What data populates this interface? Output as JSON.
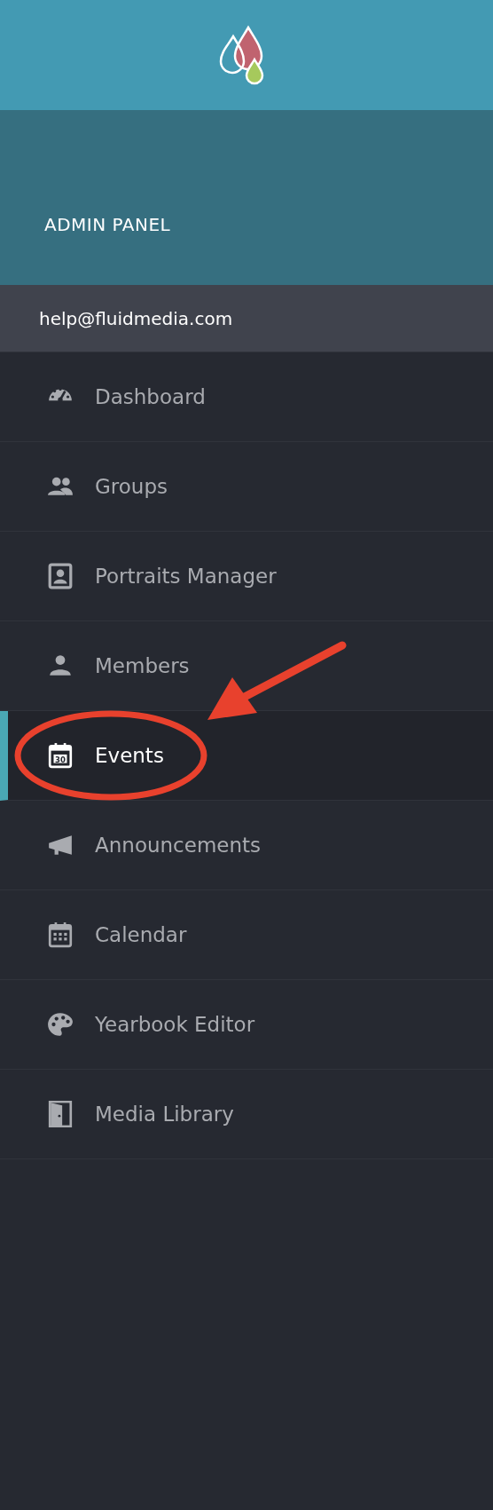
{
  "header": {
    "title": "ADMIN PANEL"
  },
  "account": {
    "email": "help@fluidmedia.com"
  },
  "menu": [
    {
      "label": "Dashboard",
      "selected": false,
      "circled": false
    },
    {
      "label": "Groups",
      "selected": false,
      "circled": false
    },
    {
      "label": "Portraits Manager",
      "selected": false,
      "circled": false
    },
    {
      "label": "Members",
      "selected": false,
      "circled": false
    },
    {
      "label": "Events",
      "icon_text": "30",
      "selected": true,
      "circled": true
    },
    {
      "label": "Announcements",
      "selected": false,
      "circled": false
    },
    {
      "label": "Calendar",
      "selected": false,
      "circled": false
    },
    {
      "label": "Yearbook Editor",
      "selected": false,
      "circled": false
    },
    {
      "label": "Media Library",
      "selected": false,
      "circled": false
    }
  ]
}
